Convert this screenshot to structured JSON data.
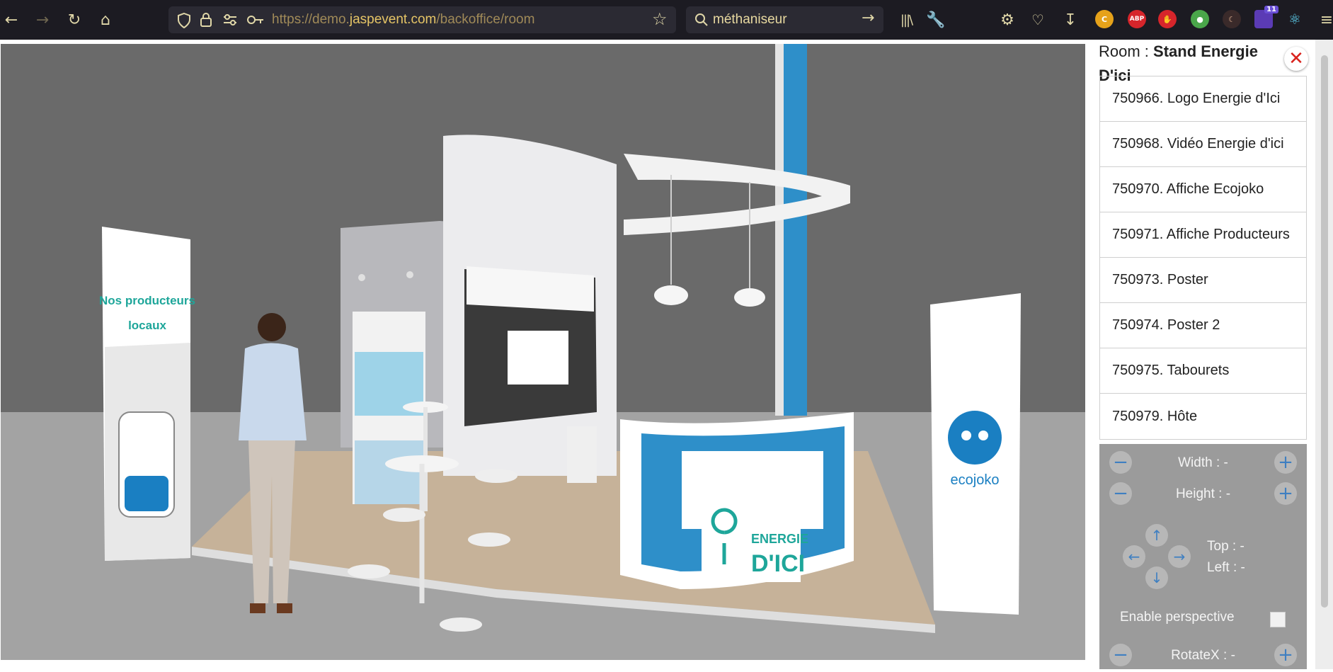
{
  "browser": {
    "url_prefix": "https://demo.",
    "url_host": "jaspevent.com",
    "url_path": "/backoffice/room",
    "search_query": "méthaniseur",
    "notification_count": "11",
    "ext_c_label": "C",
    "ext_abp_label": "ABP"
  },
  "room": {
    "label": "Room : ",
    "name": "Stand Energie D'ici",
    "close_symbol": "✕"
  },
  "items": [
    {
      "label": "750966. Logo Energie d'Ici"
    },
    {
      "label": "750968. Vidéo Energie d'ici"
    },
    {
      "label": "750970. Affiche Ecojoko"
    },
    {
      "label": "750971. Affiche Producteurs"
    },
    {
      "label": "750973. Poster"
    },
    {
      "label": "750974. Poster 2"
    },
    {
      "label": "750975. Tabourets"
    },
    {
      "label": "750979. Hôte"
    }
  ],
  "controls": {
    "width_label": "Width : -",
    "height_label": "Height : -",
    "top_label": "Top : -",
    "left_label": "Left : -",
    "perspective_label": "Enable perspective",
    "rotatex_label": "RotateX : -",
    "minus_symbol": "−",
    "plus_symbol": "+"
  },
  "scene": {
    "banner_left_line1": "Nos producteurs",
    "banner_left_line2": "locaux",
    "banner_right_brand": "ecojoko",
    "logo_line1": "ENERGIE",
    "logo_line2": "D'ICI"
  },
  "colors": {
    "accent_blue": "#3a9bd6",
    "close_red": "#d9221c",
    "teal": "#1ea69a",
    "control_bg": "#9b9b9b"
  }
}
